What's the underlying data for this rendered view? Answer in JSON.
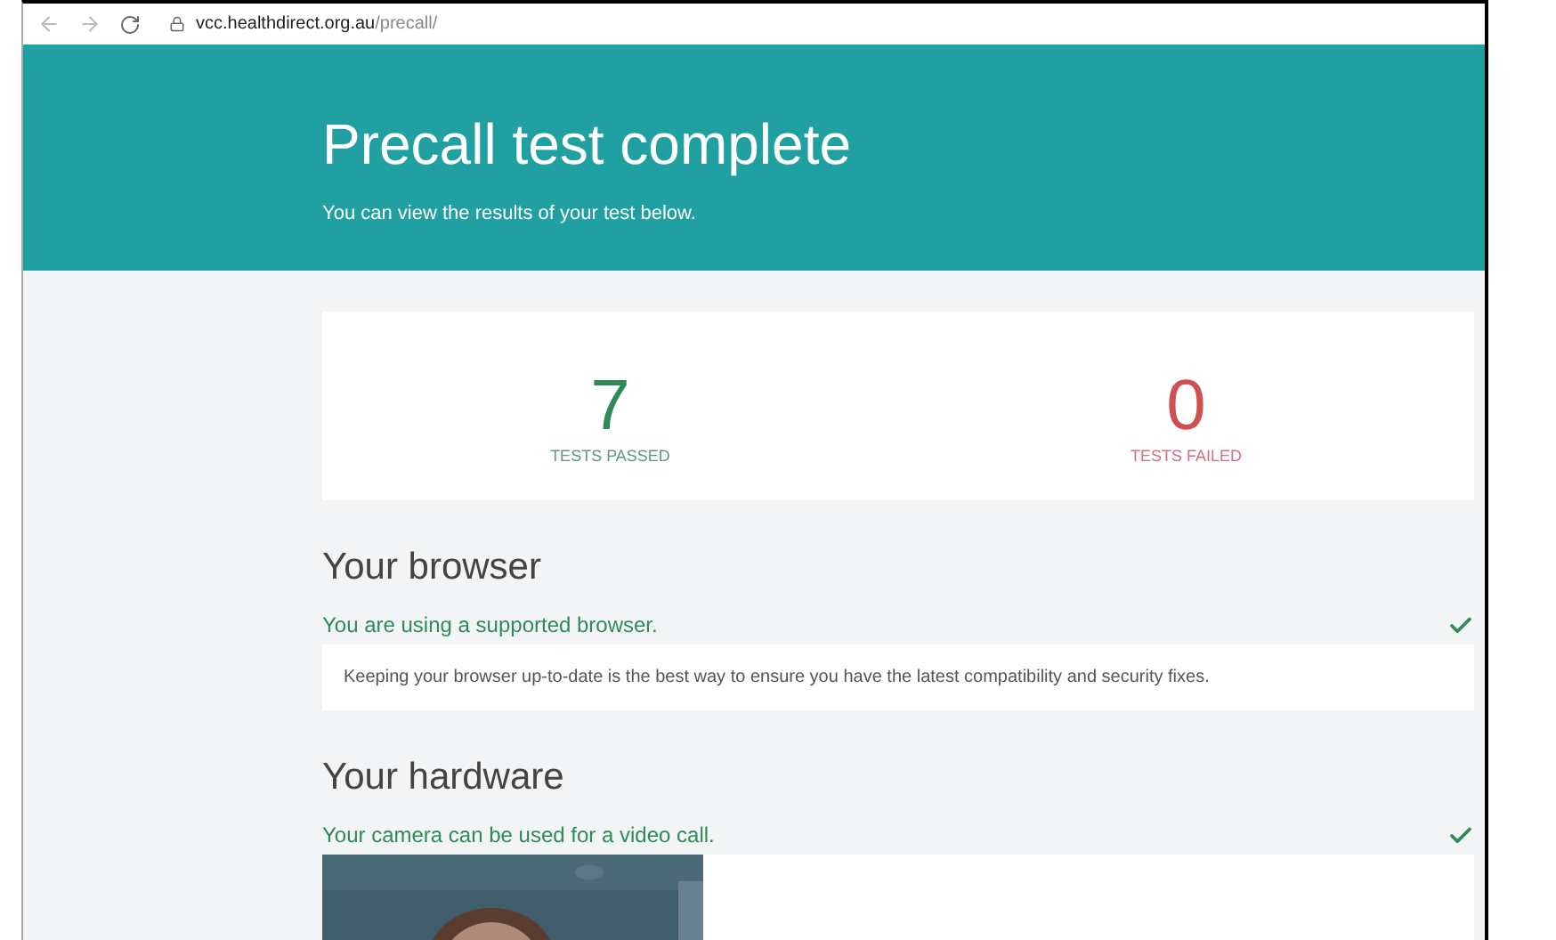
{
  "browser": {
    "url_host": "vcc.healthdirect.org.au",
    "url_path": "/precall/"
  },
  "header": {
    "title": "Precall test complete",
    "subtitle": "You can view the results of your test below."
  },
  "stats": [
    {
      "value": "7",
      "label": "TESTS PASSED",
      "kind": "passed"
    },
    {
      "value": "0",
      "label": "TESTS FAILED",
      "kind": "failed"
    }
  ],
  "sections": [
    {
      "heading": "Your browser",
      "status": "You are using a supported browser.",
      "passed": true,
      "kind": "info",
      "info": "Keeping your browser up-to-date is the best way to ensure you have the latest compatibility and security fixes."
    },
    {
      "heading": "Your hardware",
      "status": "Your camera can be used for a video call.",
      "passed": true,
      "kind": "camera"
    }
  ]
}
